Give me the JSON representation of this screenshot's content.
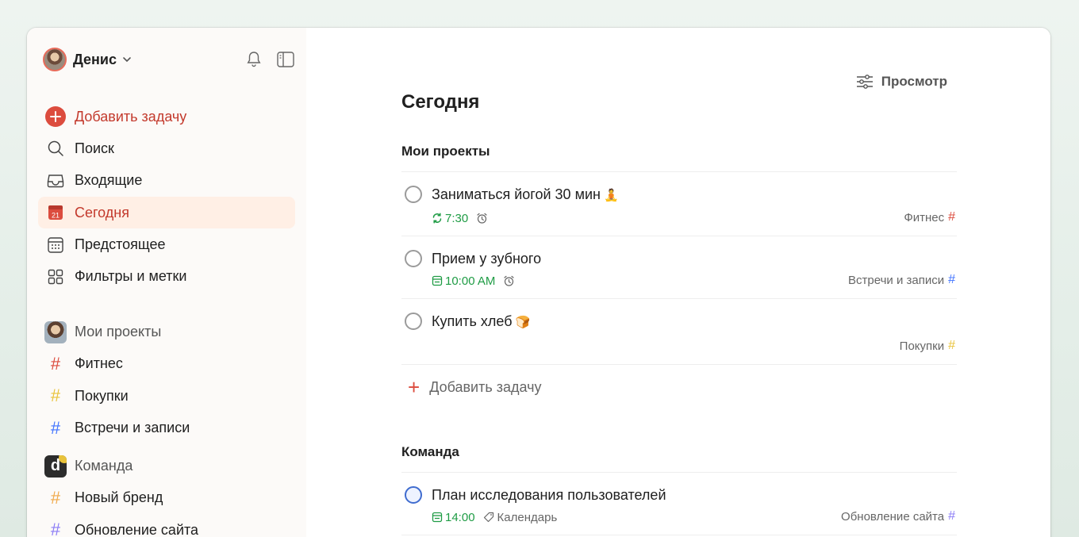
{
  "user": {
    "name": "Денис"
  },
  "sidebar": {
    "add_task": "Добавить задачу",
    "search": "Поиск",
    "inbox": "Входящие",
    "today": "Сегодня",
    "today_day": "21",
    "upcoming": "Предстоящее",
    "filters": "Фильтры и метки",
    "my_projects": "Мои проекты",
    "projects": [
      {
        "label": "Фитнес",
        "color": "#dc4c3e"
      },
      {
        "label": "Покупки",
        "color": "#e9c33c"
      },
      {
        "label": "Встречи и записи",
        "color": "#4073ff"
      }
    ],
    "team": "Команда",
    "team_initial": "d",
    "team_projects": [
      {
        "label": "Новый бренд",
        "color": "#f0a94a"
      },
      {
        "label": "Обновление сайта",
        "color": "#8b7cf6"
      }
    ]
  },
  "main": {
    "view_label": "Просмотр",
    "title": "Сегодня",
    "my_projects_title": "Мои проекты",
    "tasks": [
      {
        "title": "Заниматься йогой 30 мин",
        "emoji": "🧘",
        "time": "7:30",
        "time_icon": "recurring-icon",
        "has_alarm": true,
        "project": "Фитнес",
        "project_color": "#dc4c3e"
      },
      {
        "title": "Прием у зубного",
        "emoji": "",
        "time": "10:00 AM",
        "time_icon": "calendar-icon",
        "has_alarm": true,
        "project": "Встречи и записи",
        "project_color": "#4073ff"
      },
      {
        "title": "Купить хлеб",
        "emoji": "🍞",
        "time": "",
        "project": "Покупки",
        "project_color": "#e9c33c"
      }
    ],
    "add_task": "Добавить задачу",
    "team_title": "Команда",
    "team_tasks": [
      {
        "title": "План исследования пользователей",
        "time": "14:00",
        "label": "Календарь",
        "project": "Обновление сайта",
        "project_color": "#8b7cf6"
      }
    ]
  }
}
